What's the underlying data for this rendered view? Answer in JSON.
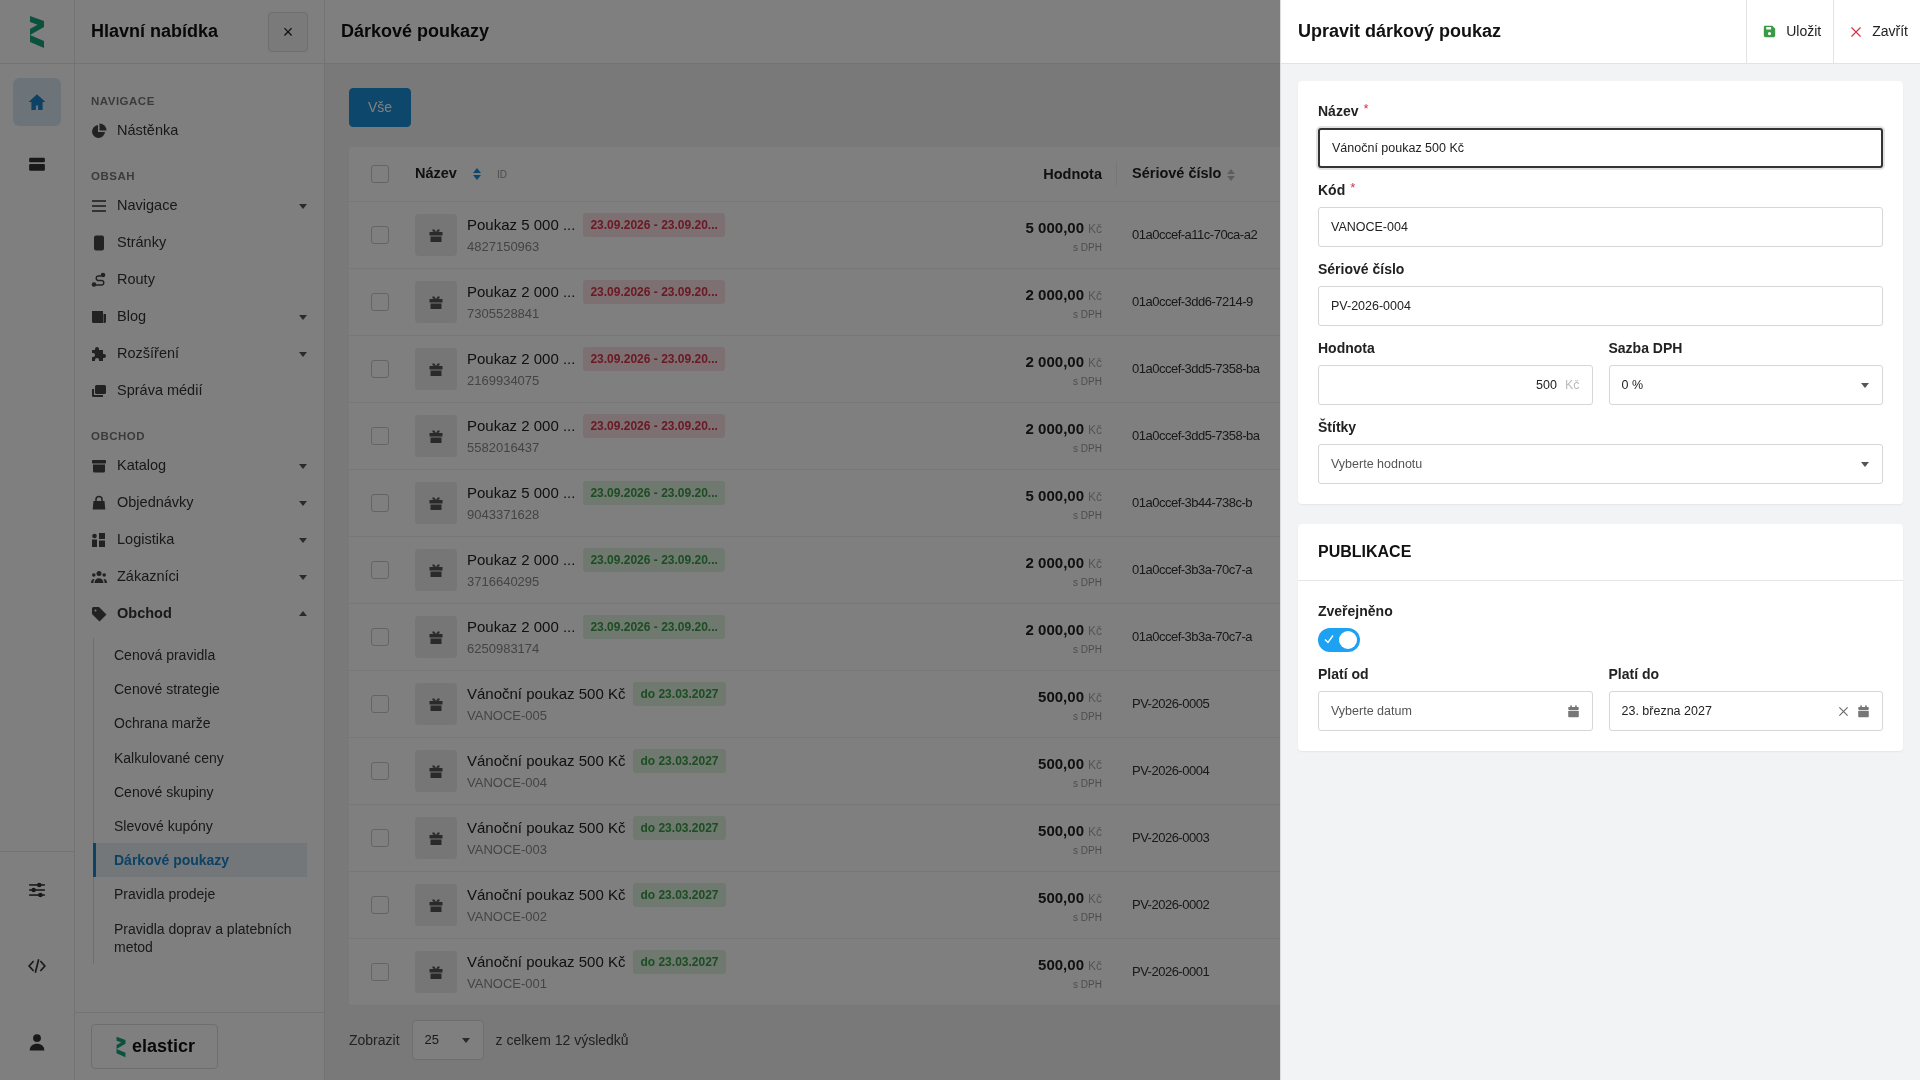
{
  "rail": {
    "items": [
      {
        "selected": true
      },
      {
        "selected": false
      }
    ],
    "bottom_items": [
      {
        "selected": false
      },
      {
        "selected": false
      },
      {
        "selected": false
      }
    ]
  },
  "sidebar": {
    "title": "Hlavní nabídka",
    "close": "×",
    "sections": [
      {
        "label": "NAVIGACE",
        "items": [
          {
            "label": "Nástěnka"
          }
        ]
      },
      {
        "label": "OBSAH",
        "items": [
          {
            "label": "Navigace",
            "expanded": false
          },
          {
            "label": "Stránky"
          },
          {
            "label": "Routy"
          },
          {
            "label": "Blog",
            "expanded": false
          },
          {
            "label": "Rozšíření",
            "expanded": false
          },
          {
            "label": "Správa médií"
          }
        ]
      },
      {
        "label": "OBCHOD",
        "items": [
          {
            "label": "Katalog",
            "expanded": false
          },
          {
            "label": "Objednávky",
            "expanded": false
          },
          {
            "label": "Logistika",
            "expanded": false
          },
          {
            "label": "Zákazníci",
            "expanded": false
          },
          {
            "label": "Obchod",
            "expanded": true,
            "children": [
              {
                "label": "Cenová pravidla",
                "selected": false
              },
              {
                "label": "Cenové strategie",
                "selected": false
              },
              {
                "label": "Ochrana marže",
                "selected": false
              },
              {
                "label": "Kalkulované ceny",
                "selected": false
              },
              {
                "label": "Cenové skupiny",
                "selected": false
              },
              {
                "label": "Slevové kupóny",
                "selected": false
              },
              {
                "label": "Dárkové poukazy",
                "selected": true
              },
              {
                "label": "Pravidla prodeje",
                "selected": false
              },
              {
                "label": "Pravidla doprav a platebních metod",
                "selected": false
              }
            ]
          }
        ]
      }
    ],
    "brand": "elasticr"
  },
  "page": {
    "title": "Dárkové poukazy",
    "filters": [
      {
        "label": "Vše",
        "selected": true
      }
    ]
  },
  "table": {
    "select_all": {
      "checked": false
    },
    "columns": [
      {
        "label": "Název",
        "sorted": true,
        "extra": "ID"
      },
      {
        "label": "Hodnota"
      },
      {
        "label": "Sériové číslo",
        "sorted": false
      }
    ],
    "rows": [
      {
        "checked": false,
        "name": "Poukaz 5 000 ...",
        "badge": {
          "text": "23.09.2026 - 23.09.20...",
          "kind": "danger"
        },
        "id": "4827150963",
        "value": "5 000,00",
        "currency": "Kč",
        "tax_note": "s DPH",
        "serial": "01a0ccef-a11c-70ca-a2"
      },
      {
        "checked": false,
        "name": "Poukaz 2 000 ...",
        "badge": {
          "text": "23.09.2026 - 23.09.20...",
          "kind": "danger"
        },
        "id": "7305528841",
        "value": "2 000,00",
        "currency": "Kč",
        "tax_note": "s DPH",
        "serial": "01a0ccef-3dd6-7214-9"
      },
      {
        "checked": false,
        "name": "Poukaz 2 000 ...",
        "badge": {
          "text": "23.09.2026 - 23.09.20...",
          "kind": "danger"
        },
        "id": "2169934075",
        "value": "2 000,00",
        "currency": "Kč",
        "tax_note": "s DPH",
        "serial": "01a0ccef-3dd5-7358-ba"
      },
      {
        "checked": false,
        "name": "Poukaz 2 000 ...",
        "badge": {
          "text": "23.09.2026 - 23.09.20...",
          "kind": "danger"
        },
        "id": "5582016437",
        "value": "2 000,00",
        "currency": "Kč",
        "tax_note": "s DPH",
        "serial": "01a0ccef-3dd5-7358-ba"
      },
      {
        "checked": false,
        "name": "Poukaz 5 000 ...",
        "badge": {
          "text": "23.09.2026 - 23.09.20...",
          "kind": "success"
        },
        "id": "9043371628",
        "value": "5 000,00",
        "currency": "Kč",
        "tax_note": "s DPH",
        "serial": "01a0ccef-3b44-738c-b"
      },
      {
        "checked": false,
        "name": "Poukaz 2 000 ...",
        "badge": {
          "text": "23.09.2026 - 23.09.20...",
          "kind": "success"
        },
        "id": "3716640295",
        "value": "2 000,00",
        "currency": "Kč",
        "tax_note": "s DPH",
        "serial": "01a0ccef-3b3a-70c7-a"
      },
      {
        "checked": false,
        "name": "Poukaz 2 000 ...",
        "badge": {
          "text": "23.09.2026 - 23.09.20...",
          "kind": "success"
        },
        "id": "6250983174",
        "value": "2 000,00",
        "currency": "Kč",
        "tax_note": "s DPH",
        "serial": "01a0ccef-3b3a-70c7-a"
      },
      {
        "checked": false,
        "name": "Vánoční poukaz 500 Kč",
        "badge": {
          "text": "do 23.03.2027",
          "kind": "success"
        },
        "id": "VANOCE-005",
        "value": "500,00",
        "currency": "Kč",
        "tax_note": "s DPH",
        "serial": "PV-2026-0005"
      },
      {
        "checked": false,
        "name": "Vánoční poukaz 500 Kč",
        "badge": {
          "text": "do 23.03.2027",
          "kind": "success"
        },
        "id": "VANOCE-004",
        "value": "500,00",
        "currency": "Kč",
        "tax_note": "s DPH",
        "serial": "PV-2026-0004"
      },
      {
        "checked": false,
        "name": "Vánoční poukaz 500 Kč",
        "badge": {
          "text": "do 23.03.2027",
          "kind": "success"
        },
        "id": "VANOCE-003",
        "value": "500,00",
        "currency": "Kč",
        "tax_note": "s DPH",
        "serial": "PV-2026-0003"
      },
      {
        "checked": false,
        "name": "Vánoční poukaz 500 Kč",
        "badge": {
          "text": "do 23.03.2027",
          "kind": "success"
        },
        "id": "VANOCE-002",
        "value": "500,00",
        "currency": "Kč",
        "tax_note": "s DPH",
        "serial": "PV-2026-0002"
      },
      {
        "checked": false,
        "name": "Vánoční poukaz 500 Kč",
        "badge": {
          "text": "do 23.03.2027",
          "kind": "success"
        },
        "id": "VANOCE-001",
        "value": "500,00",
        "currency": "Kč",
        "tax_note": "s DPH",
        "serial": "PV-2026-0001"
      }
    ]
  },
  "pagination": {
    "label": "Zobrazit",
    "page_size": "25",
    "summary": "z celkem 12 výsledků"
  },
  "panel": {
    "title": "Upravit dárkový poukaz",
    "actions": [
      {
        "label": "Uložit",
        "kind": "save"
      },
      {
        "label": "Zavřít",
        "kind": "close"
      }
    ],
    "form": {
      "rows": [
        [
          {
            "kind": "text",
            "label": "Název",
            "required_mark": "*",
            "focused": true,
            "value": "Vánoční poukaz 500 Kč"
          }
        ],
        [
          {
            "kind": "text",
            "label": "Kód",
            "required_mark": "*",
            "focused": false,
            "value": "VANOCE-004"
          }
        ],
        [
          {
            "kind": "text",
            "label": "Sériové číslo",
            "focused": false,
            "value": "PV-2026-0004"
          }
        ],
        [
          {
            "kind": "money",
            "label": "Hodnota",
            "focused": false,
            "value": "500",
            "unit": "Kč"
          },
          {
            "kind": "select",
            "label": "Sazba DPH",
            "focused": false,
            "value": "0 %"
          }
        ],
        [
          {
            "kind": "select",
            "label": "Štítky",
            "focused": false,
            "placeholder": "Vyberte hodnotu"
          }
        ]
      ]
    },
    "publication": {
      "title": "PUBLIKACE",
      "toggle": {
        "label": "Zveřejněno",
        "on": true
      },
      "rows": [
        [
          {
            "kind": "date",
            "label": "Platí od",
            "focused": false,
            "placeholder": "Vyberte datum"
          },
          {
            "kind": "date",
            "label": "Platí do",
            "focused": false,
            "value": "23. března 2027"
          }
        ]
      ]
    }
  }
}
